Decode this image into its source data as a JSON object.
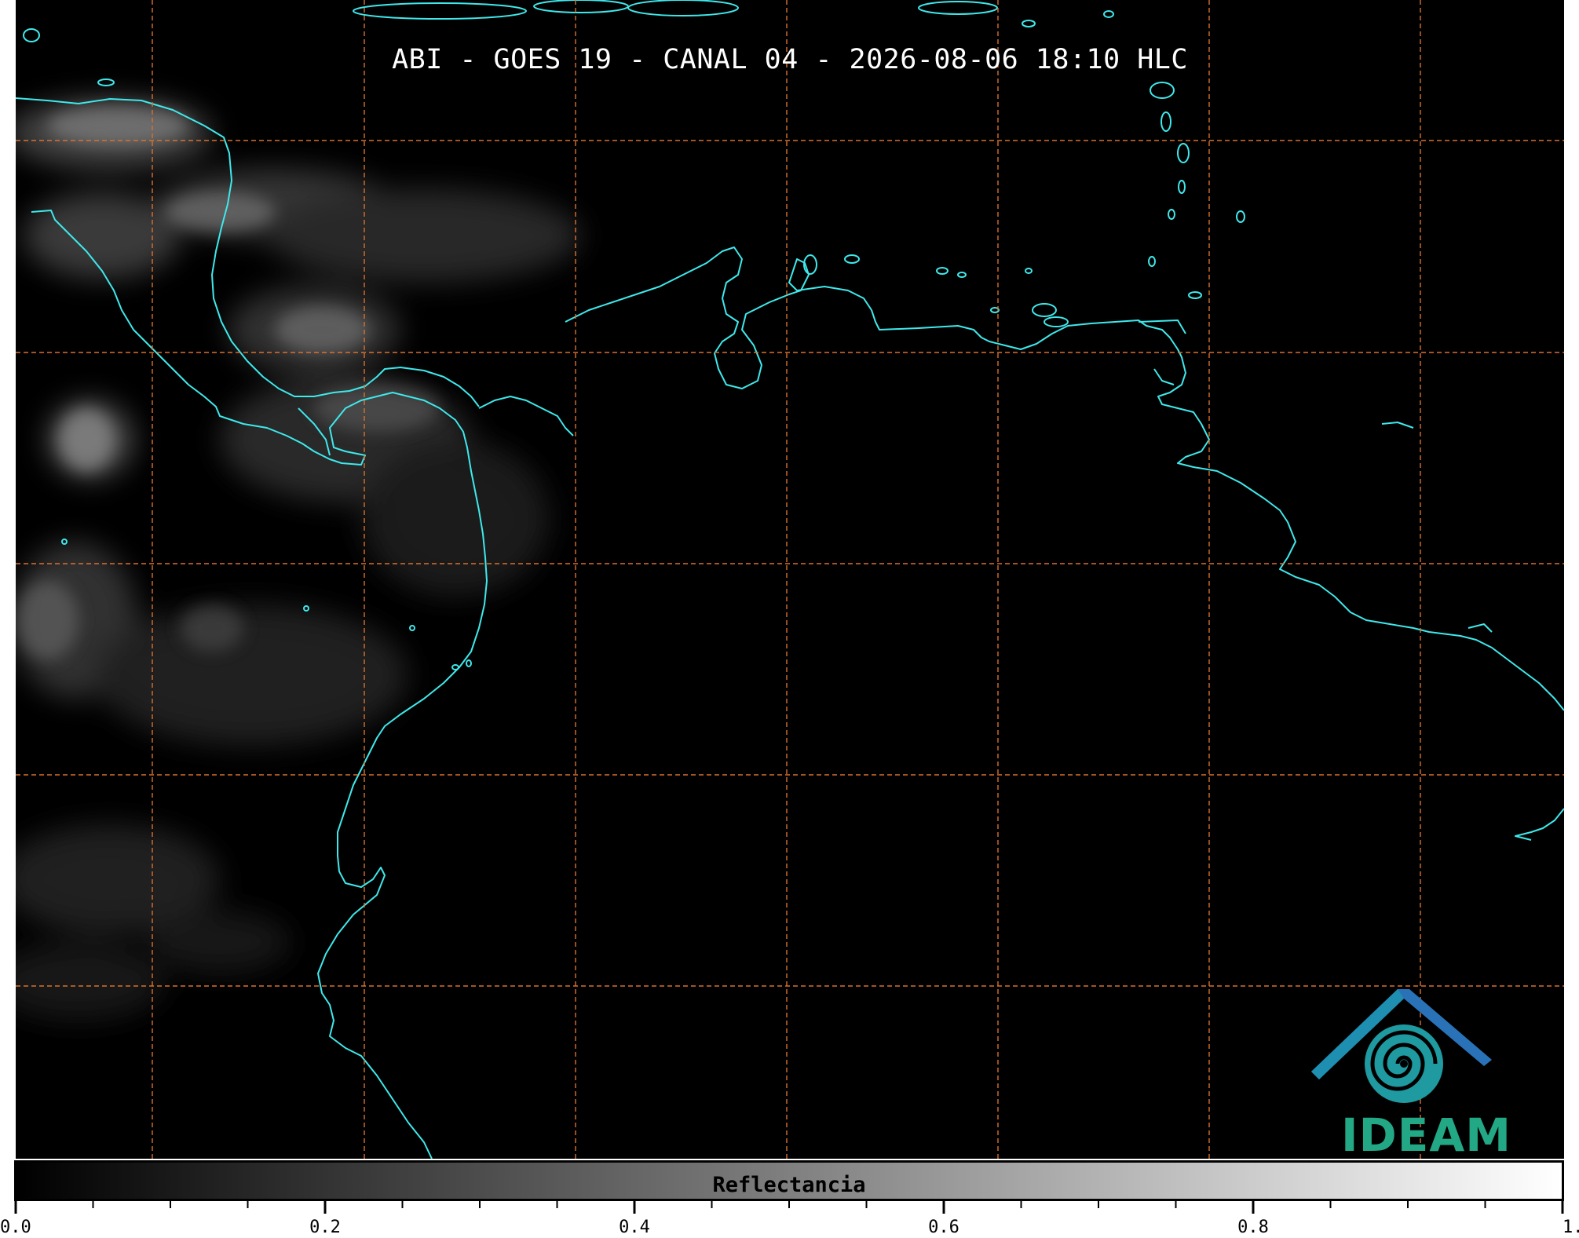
{
  "title": "ABI - GOES 19 - CANAL 04 - 2026-08-06 18:10 HLC",
  "map": {
    "background_color": "#000000",
    "coastline_color": "#3fe9ec",
    "grid_color": "#d9712f",
    "cloud_color": "#8a8a8a"
  },
  "logo": {
    "text": "IDEAM",
    "colors": [
      "#2a72b8",
      "#1e9aa0",
      "#23a886"
    ],
    "icon": "ideam-logo-icon"
  },
  "colorbar": {
    "label": "Reflectancia",
    "min": 0.0,
    "max": 1.0,
    "colormap": [
      "#000000",
      "#ffffff"
    ],
    "tick_labels": [
      "0.0",
      "0.2",
      "0.4",
      "0.6",
      "0.8",
      "1.0"
    ],
    "tick_values": [
      0.0,
      0.2,
      0.4,
      0.6,
      0.8,
      1.0
    ],
    "minor_tick_values": [
      0.05,
      0.1,
      0.15,
      0.25,
      0.3,
      0.35,
      0.45,
      0.5,
      0.55,
      0.65,
      0.7,
      0.75,
      0.85,
      0.9,
      0.95
    ]
  }
}
